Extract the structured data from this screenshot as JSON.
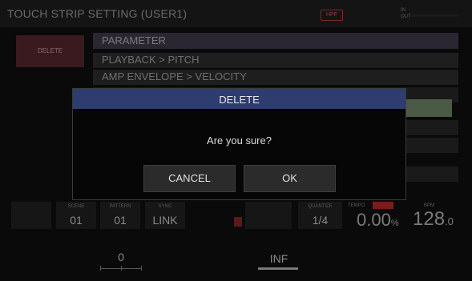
{
  "screen": {
    "title": "TOUCH STRIP SETTING (USER1)",
    "hpf_badge": "HPF",
    "in_out_label": "IN\nOUT"
  },
  "side": {
    "delete_label": "DELETE"
  },
  "parameter": {
    "header": "PARAMETER",
    "rows": [
      "PLAYBACK > PITCH",
      "AMP ENVELOPE > VELOCITY"
    ]
  },
  "transport": {
    "scene_label": "SCENE",
    "scene_value": "01",
    "pattern_label": "PATTERN",
    "pattern_value": "01",
    "sync_label": "SYNC",
    "sync_value": "LINK",
    "quantize_label": "QUANTIZE",
    "quantize_value": "1/4",
    "tempo_label": "TEMPO",
    "tempo_value": "0.00",
    "tempo_unit": "%",
    "bpm_label": "BPM",
    "bpm_value": "128",
    "bpm_decimal": ".0"
  },
  "knobs": {
    "left_value": "0",
    "right_value": "INF"
  },
  "dialog": {
    "title": "DELETE",
    "message": "Are you sure?",
    "cancel_label": "CANCEL",
    "ok_label": "OK"
  },
  "colors": {
    "dialog_header": "#2e3d6e",
    "delete_side": "#3a1a1f",
    "accent_red": "#7a1c1c"
  }
}
